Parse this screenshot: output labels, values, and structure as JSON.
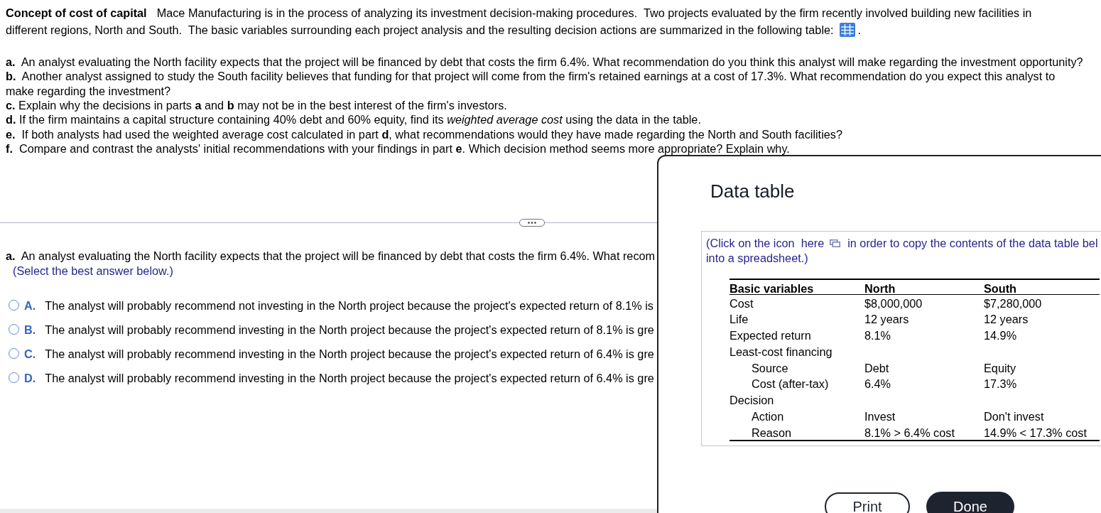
{
  "problem": {
    "title": "Concept of cost of capital",
    "intro_lines": [
      "Mace Manufacturing is in the process of analyzing its investment decision-making procedures.  Two projects evaluated by the firm recently involved building new facilities in",
      "different regions, North and South.  The basic variables surrounding each project analysis and the resulting decision actions are summarized in the following table:"
    ],
    "intro_end": "."
  },
  "questions": [
    "**a.**  An analyst evaluating the North facility expects that the project will be financed by debt that costs the firm 6.4%. What recommendation do you think this analyst will make regarding the investment opportunity?",
    "**b.**  Another analyst assigned to study the South facility believes that funding for that project will come from the firm's retained earnings at a cost of 17.3%. What recommendation do you expect this analyst to make regarding the investment?",
    "**c.** Explain why the decisions in parts **a** and **b** may not be in the best interest of the firm's investors.",
    "**d.** If the firm maintains a capital structure containing 40% debt and 60% equity, find its *weighted average cost* using the data in the table.",
    "**e.**  If both analysts had used the weighted average cost calculated in part **d**, what recommendations would they have made regarding the North and South facilities?",
    "**f.**  Compare and contrast the analysts' initial recommendations with your findings in part **e**. Which decision method seems more appropriate? Explain why."
  ],
  "question_a": {
    "prompt": "**a.**  An analyst evaluating the North facility expects that the project will be financed by debt that costs the firm 6.4%. What recom",
    "hint": "(Select the best answer below.)",
    "options": [
      {
        "letter": "A.",
        "text": "The analyst will probably recommend not investing in the North project because the project's expected return of 8.1% is",
        "selected": false
      },
      {
        "letter": "B.",
        "text": "The analyst will probably recommend investing in the North project because the project's expected return of 8.1% is gre",
        "selected": false
      },
      {
        "letter": "C.",
        "text": "The analyst will probably recommend investing in the North project because the project's expected return of 6.4% is gre",
        "selected": false
      },
      {
        "letter": "D.",
        "text": "The analyst will probably recommend investing in the North project because the project's expected return of 6.4% is gre",
        "selected": false
      }
    ]
  },
  "data_table_dialog": {
    "title": "Data table",
    "copy_hint": {
      "before_icon": "(Click on the icon  here",
      "after_icon": "in order to copy the contents of the data table bel",
      "line_2": "into a spreadsheet.)"
    },
    "table": {
      "columns": [
        "Basic variables",
        "North",
        "South"
      ],
      "rows": [
        {
          "label": "Cost",
          "values": [
            "$8,000,000",
            "$7,280,000"
          ]
        },
        {
          "label": "Life",
          "values": [
            "12 years",
            "12 years"
          ]
        },
        {
          "label": "Expected return",
          "values": [
            "8.1%",
            "14.9%"
          ]
        },
        {
          "label": "Least-cost financing",
          "children": [
            {
              "label": "Source",
              "values": [
                "Debt",
                "Equity"
              ]
            },
            {
              "label": "Cost (after-tax)",
              "values": [
                "6.4%",
                "17.3%"
              ]
            }
          ]
        },
        {
          "label": "Decision",
          "children": [
            {
              "label": "Action",
              "values": [
                "Invest",
                "Don't invest"
              ]
            },
            {
              "label": "Reason",
              "values": [
                "8.1% > 6.4% cost",
                "14.9% < 17.3% cost"
              ]
            }
          ]
        }
      ]
    },
    "buttons": [
      {
        "label": "Print",
        "kind": "outline"
      },
      {
        "label": "Done",
        "kind": "filled"
      }
    ]
  }
}
